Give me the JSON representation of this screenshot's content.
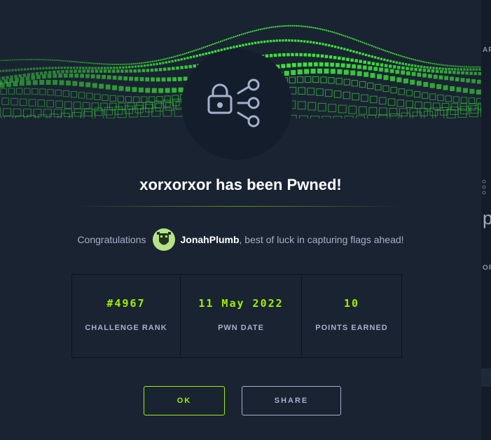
{
  "dialog": {
    "title": "xorxorxor has been Pwned!",
    "congrats_prefix": "Congratulations",
    "username": "JonahPlumb",
    "congrats_suffix": ", best of luck in capturing flags ahead!",
    "stats": [
      {
        "value": "#4967",
        "label": "CHALLENGE RANK"
      },
      {
        "value": "11 May 2022",
        "label": "PWN DATE"
      },
      {
        "value": "10",
        "label": "POINTS EARNED"
      }
    ],
    "ok_label": "OK",
    "share_label": "SHARE"
  },
  "background_panel": {
    "text_top": "AR",
    "text_big": "p",
    "text_mid": "OR"
  },
  "icons": {
    "challenge_icon": "lock-network-icon",
    "avatar": "user-avatar"
  },
  "colors": {
    "accent": "#9fef00",
    "modal_bg": "#1a2332",
    "text_muted": "#a4b1cd"
  }
}
